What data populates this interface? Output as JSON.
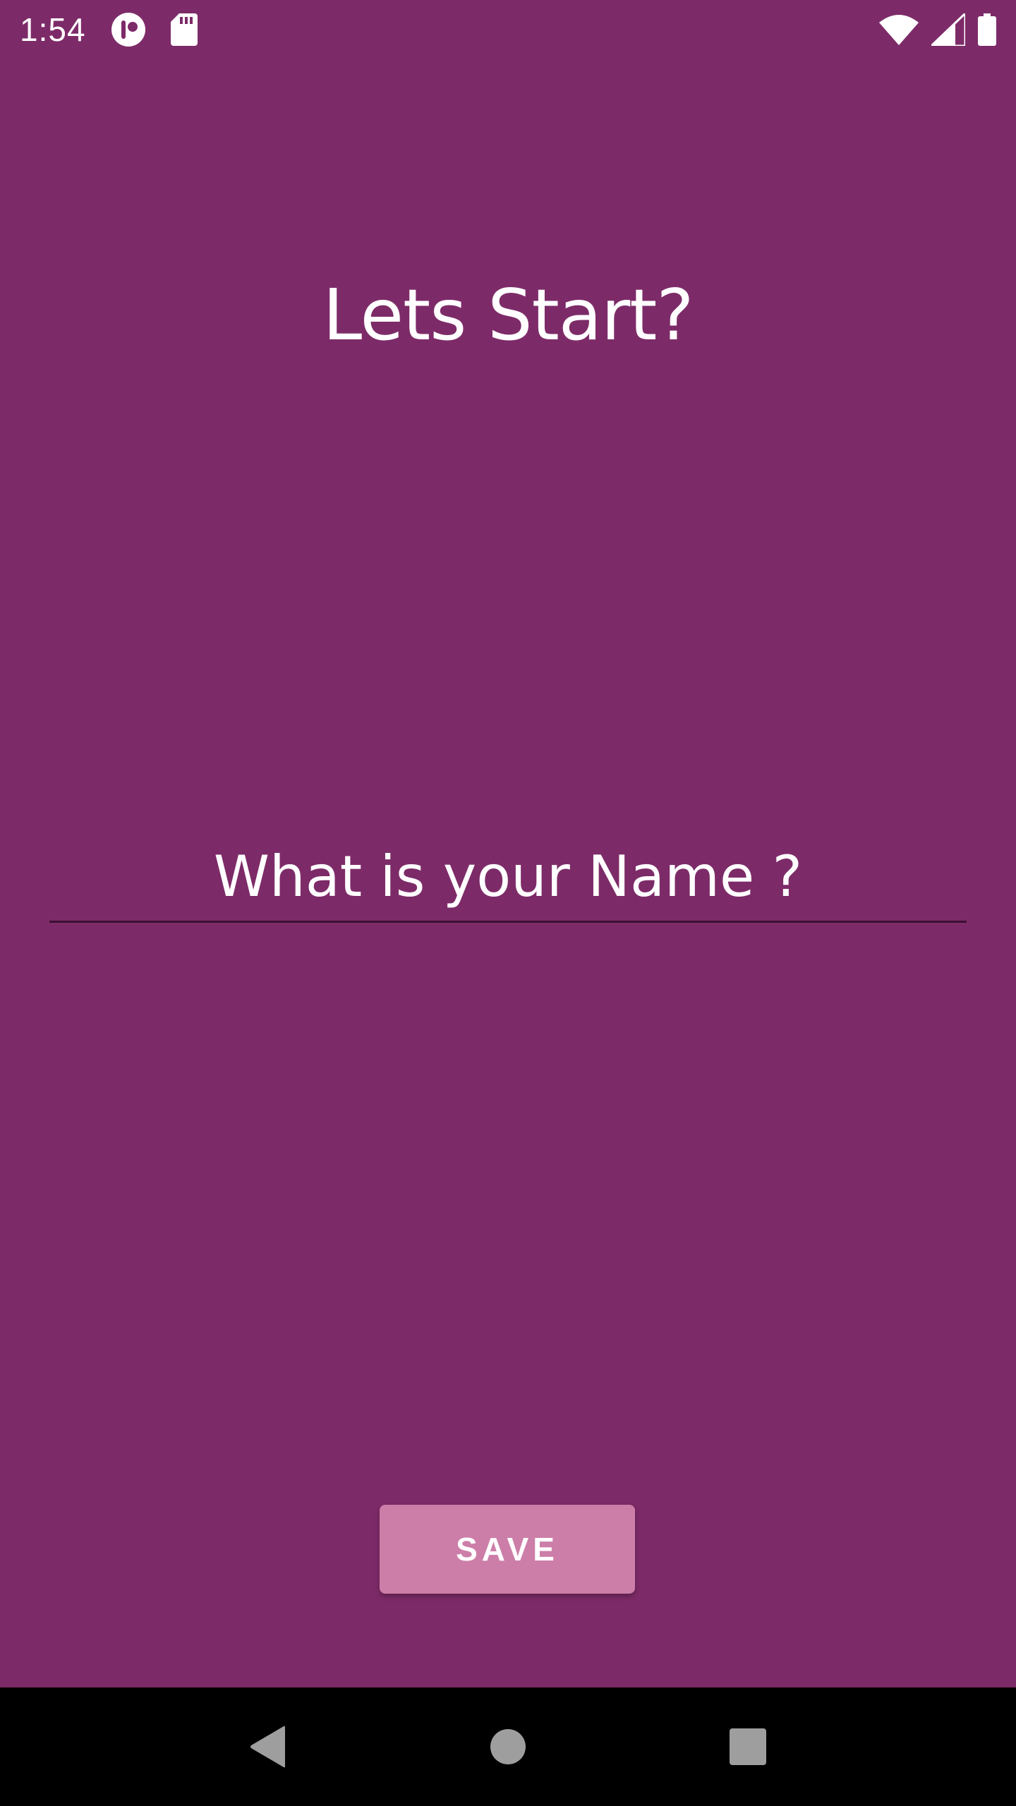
{
  "status_bar": {
    "time": "1:54",
    "icons": [
      "sync-icon",
      "sd-card-icon",
      "wifi-icon",
      "signal-icon",
      "battery-icon"
    ]
  },
  "main": {
    "title": "Lets Start?",
    "name_input": {
      "placeholder": "What is your Name ?",
      "value": ""
    },
    "save_label": "SAVE"
  },
  "nav_bar": {
    "icons": [
      "back-icon",
      "home-icon",
      "recents-icon"
    ]
  },
  "colors": {
    "background": "#7d2b68",
    "button": "#cc7ea8",
    "underline": "#3d0e33",
    "nav_background": "#000000",
    "nav_icon": "#9e9e9e"
  }
}
